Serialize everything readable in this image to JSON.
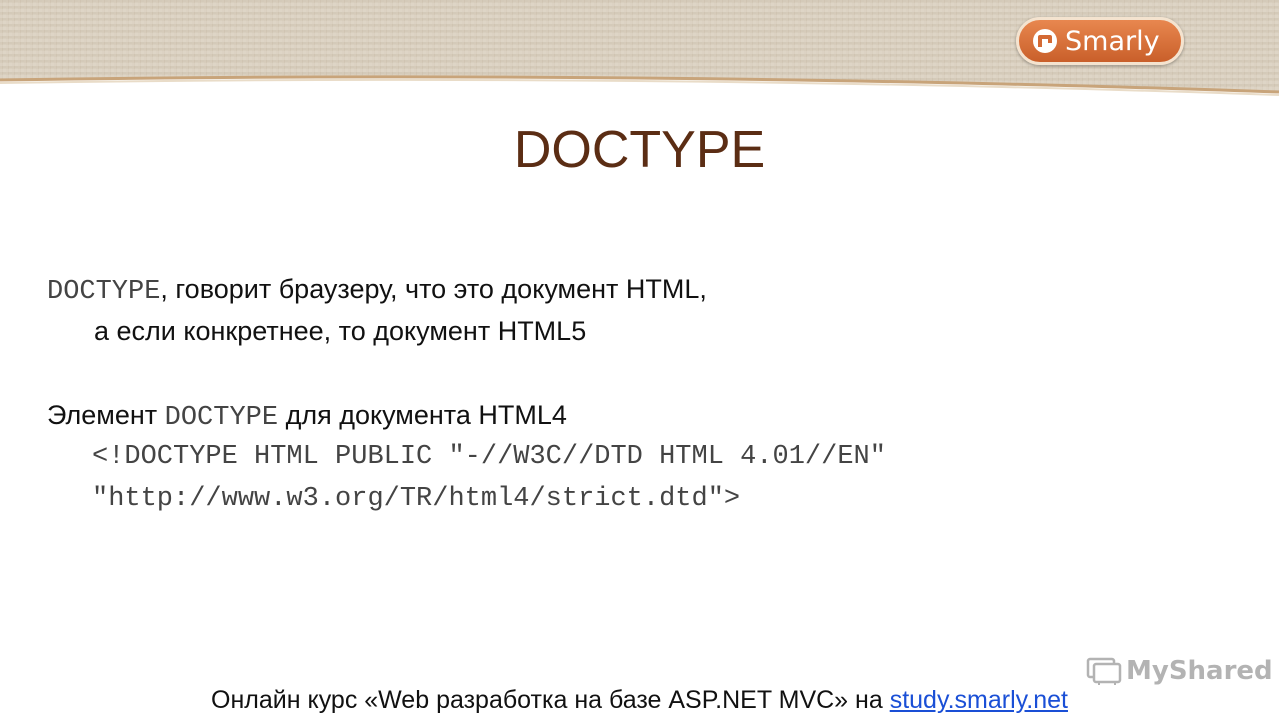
{
  "brand": {
    "logo_text": "Smarly",
    "accent": "#d46a34"
  },
  "slide": {
    "title": "DOCTYPE",
    "para1": {
      "term": "DOCTYPE",
      "line1_rest": ", говорит браузеру, что это документ HTML,",
      "line2": "а если конкретнее, то документ HTML5"
    },
    "para2": {
      "prefix": "Элемент ",
      "term": "DOCTYPE",
      "suffix": " для документа HTML4",
      "code_line1": "<!DOCTYPE HTML PUBLIC \"-//W3C//DTD HTML 4.01//EN\"",
      "code_line2": "\"http://www.w3.org/TR/html4/strict.dtd\">"
    }
  },
  "footer": {
    "text": "Онлайн курс «Web разработка на базе ASP.NET MVC» на ",
    "link_text": "study.smarly.net"
  },
  "watermark": {
    "text": "MyShared"
  }
}
